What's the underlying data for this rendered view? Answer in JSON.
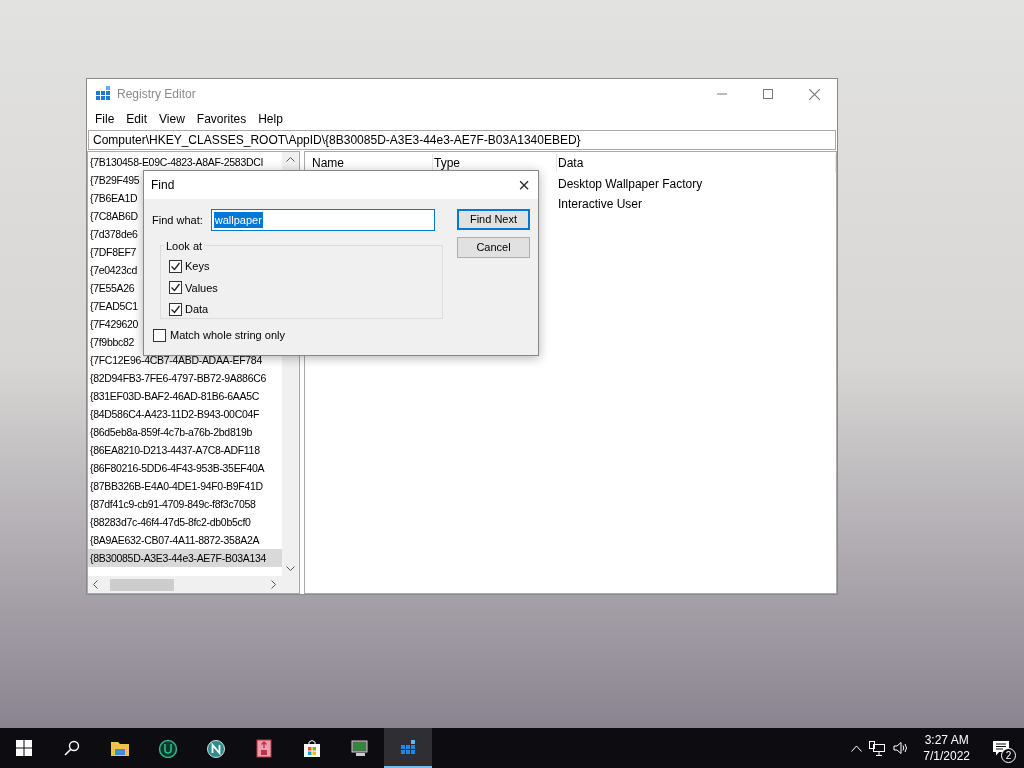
{
  "window": {
    "title": "Registry Editor",
    "menu": [
      "File",
      "Edit",
      "View",
      "Favorites",
      "Help"
    ],
    "address": "Computer\\HKEY_CLASSES_ROOT\\AppID\\{8B30085D-A3E3-44e3-AE7F-B03A1340EBED}"
  },
  "tree": {
    "items": [
      {
        "label": "{7B130458-E09C-4823-A8AF-2583DCI",
        "selected": false
      },
      {
        "label": "{7B29F495",
        "selected": false
      },
      {
        "label": "{7B6EA1D",
        "selected": false
      },
      {
        "label": "{7C8AB6D",
        "selected": false
      },
      {
        "label": "{7d378de6",
        "selected": false
      },
      {
        "label": "{7DF8EF7",
        "selected": false
      },
      {
        "label": "{7e0423cd",
        "selected": false
      },
      {
        "label": "{7E55A26",
        "selected": false
      },
      {
        "label": "{7EAD5C1",
        "selected": false
      },
      {
        "label": "{7F429620",
        "selected": false
      },
      {
        "label": "{7f9bbc82",
        "selected": false
      },
      {
        "label": "{7FC12E96-4CB7-4ABD-ADAA-EF784",
        "selected": false
      },
      {
        "label": "{82D94FB3-7FE6-4797-BB72-9A886C6",
        "selected": false
      },
      {
        "label": "{831EF03D-BAF2-46AD-81B6-6AA5C",
        "selected": false
      },
      {
        "label": "{84D586C4-A423-11D2-B943-00C04F",
        "selected": false
      },
      {
        "label": "{86d5eb8a-859f-4c7b-a76b-2bd819b",
        "selected": false
      },
      {
        "label": "{86EA8210-D213-4437-A7C8-ADF118",
        "selected": false
      },
      {
        "label": "{86F80216-5DD6-4F43-953B-35EF40A",
        "selected": false
      },
      {
        "label": "{87BB326B-E4A0-4DE1-94F0-B9F41D",
        "selected": false
      },
      {
        "label": "{87df41c9-cb91-4709-849c-f8f3c7058",
        "selected": false
      },
      {
        "label": "{88283d7c-46f4-47d5-8fc2-db0b5cf0",
        "selected": false
      },
      {
        "label": "{8A9AE632-CB07-4A11-8872-358A2A",
        "selected": false
      },
      {
        "label": "{8B30085D-A3E3-44e3-AE7F-B03A134",
        "selected": true
      }
    ]
  },
  "values": {
    "columns": [
      "Name",
      "Type",
      "Data"
    ],
    "rows": [
      {
        "data": "Desktop Wallpaper Factory"
      },
      {
        "data": "Interactive User"
      }
    ]
  },
  "find_dialog": {
    "title": "Find",
    "close": "×",
    "find_what_label": "Find what:",
    "find_what_value": "wallpaper",
    "look_at_label": "Look at",
    "options": [
      {
        "label": "Keys",
        "checked": true
      },
      {
        "label": "Values",
        "checked": true
      },
      {
        "label": "Data",
        "checked": true
      }
    ],
    "match_whole": {
      "label": "Match whole string only",
      "checked": false
    },
    "buttons": [
      {
        "label": "Find Next",
        "default": true
      },
      {
        "label": "Cancel",
        "default": false
      }
    ]
  },
  "taskbar": {
    "apps": [
      {
        "active": false
      },
      {
        "active": false
      },
      {
        "active": false
      },
      {
        "active": false
      },
      {
        "active": false
      },
      {
        "active": false
      },
      {
        "active": true
      }
    ],
    "time": "3:27 AM",
    "date": "7/1/2022",
    "notifications": "2"
  }
}
